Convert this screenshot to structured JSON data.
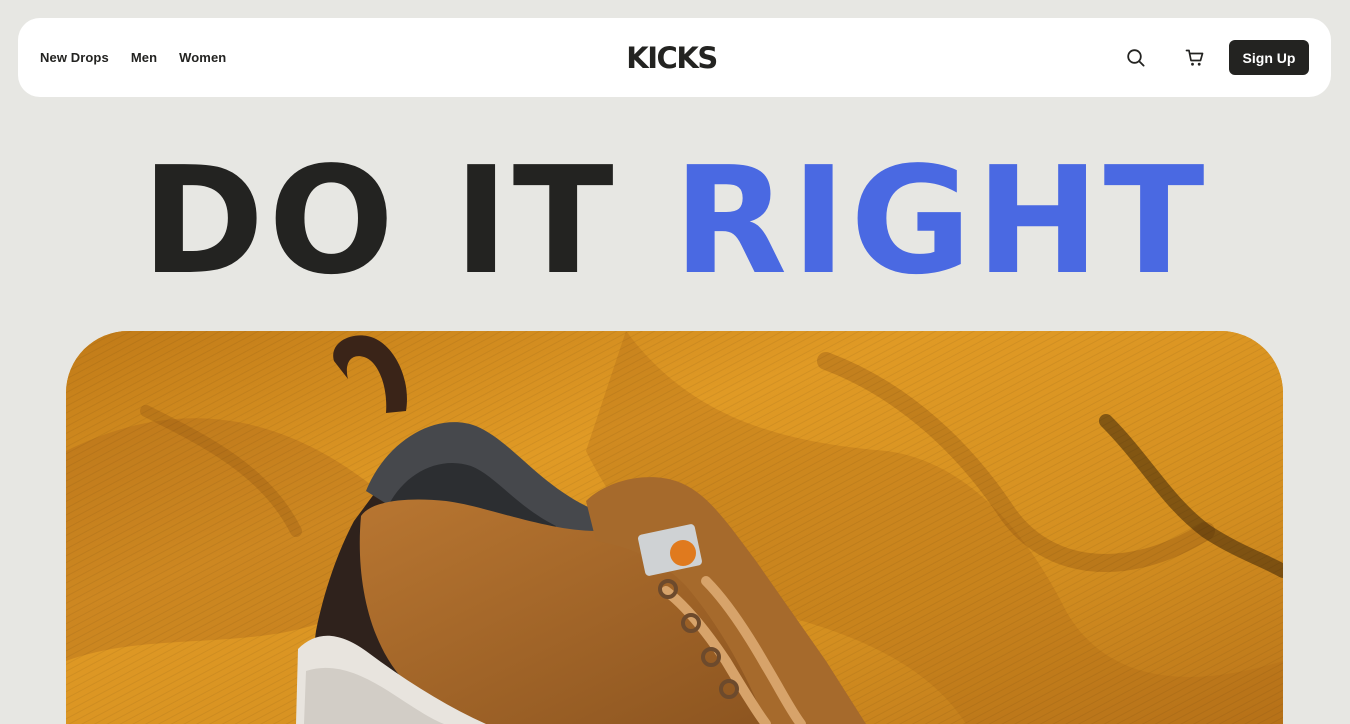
{
  "nav": {
    "links": [
      {
        "label": "New Drops"
      },
      {
        "label": "Men"
      },
      {
        "label": "Women"
      }
    ],
    "logo_text": "KICKS",
    "icons": {
      "search": "search-icon",
      "cart": "cart-icon"
    },
    "signup_label": "Sign Up"
  },
  "hero": {
    "title_part1": "DO IT",
    "title_part2": "RIGHT",
    "banner_image": "sneaker-on-mustard-corduroy-photo"
  },
  "colors": {
    "background": "#e7e7e3",
    "nav_bg": "#ffffff",
    "dark": "#232321",
    "accent_blue": "#4a69e2",
    "banner_mustard": "#d18d1f"
  }
}
